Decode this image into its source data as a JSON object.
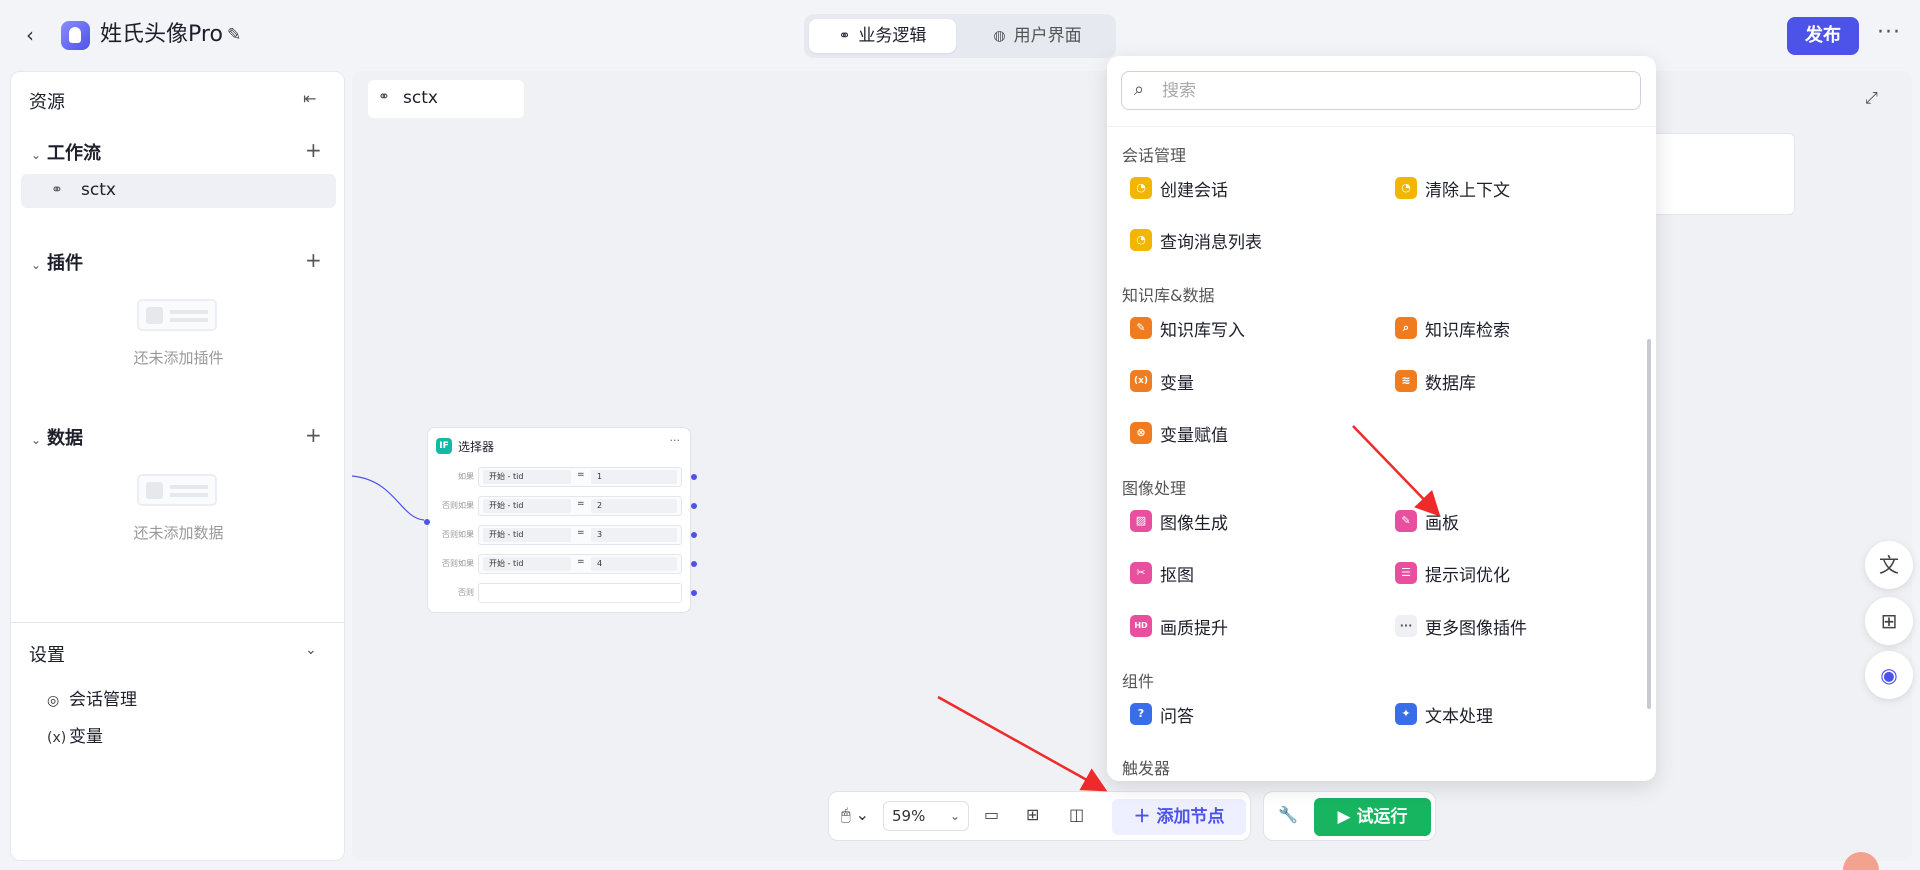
{
  "header": {
    "app_title": "姓氏头像Pro",
    "tabs": [
      {
        "label": "业务逻辑",
        "active": true
      },
      {
        "label": "用户界面",
        "active": false
      }
    ],
    "publish_label": "发布"
  },
  "sidebar": {
    "title": "资源",
    "workflow": {
      "title": "工作流",
      "items": [
        {
          "label": "sctx"
        }
      ]
    },
    "plugins": {
      "title": "插件",
      "empty_text": "还未添加插件"
    },
    "data": {
      "title": "数据",
      "empty_text": "还未添加数据"
    },
    "settings": {
      "title": "设置",
      "items": [
        {
          "label": "会话管理",
          "icon": "chat-icon"
        },
        {
          "label": "变量",
          "icon": "variable-icon",
          "prefix": "(x)"
        }
      ]
    }
  },
  "canvas": {
    "workflow_tab": "sctx",
    "selector_node": {
      "title": "选择器",
      "icon_text": "IF",
      "conditions": [
        {
          "label": "如果",
          "var": "开始 - tid",
          "op": "=",
          "value": "1"
        },
        {
          "label": "否则如果",
          "var": "开始 - tid",
          "op": "=",
          "value": "2"
        },
        {
          "label": "否则如果",
          "var": "开始 - tid",
          "op": "=",
          "value": "3"
        },
        {
          "label": "否则如果",
          "var": "开始 - tid",
          "op": "=",
          "value": "4"
        }
      ],
      "else_label": "否则"
    }
  },
  "toolbar": {
    "zoom": "59%",
    "add_node_label": "添加节点",
    "run_label": "试运行"
  },
  "picker": {
    "search_placeholder": "搜索",
    "categories": [
      {
        "title": "会话管理",
        "items": [
          {
            "label": "创建会话",
            "color": "#f2b600"
          },
          {
            "label": "清除上下文",
            "color": "#f2b600"
          },
          {
            "label": "查询消息列表",
            "color": "#f2b600"
          }
        ]
      },
      {
        "title": "知识库&数据",
        "items": [
          {
            "label": "知识库写入",
            "color": "#f07c21"
          },
          {
            "label": "知识库检索",
            "color": "#f07c21"
          },
          {
            "label": "变量",
            "color": "#f07c21"
          },
          {
            "label": "数据库",
            "color": "#f07c21"
          },
          {
            "label": "变量赋值",
            "color": "#f07c21"
          }
        ]
      },
      {
        "title": "图像处理",
        "items": [
          {
            "label": "图像生成",
            "color": "#e84f9f"
          },
          {
            "label": "画板",
            "color": "#e84f9f"
          },
          {
            "label": "抠图",
            "color": "#e84f9f"
          },
          {
            "label": "提示词优化",
            "color": "#e84f9f"
          },
          {
            "label": "画质提升",
            "color": "#e84f9f"
          },
          {
            "label": "更多图像插件",
            "color": "#eef0f4"
          }
        ]
      },
      {
        "title": "组件",
        "items": [
          {
            "label": "问答",
            "color": "#3a6ee8"
          },
          {
            "label": "文本处理",
            "color": "#3a6ee8"
          }
        ]
      },
      {
        "title": "触发器",
        "items": []
      }
    ]
  }
}
